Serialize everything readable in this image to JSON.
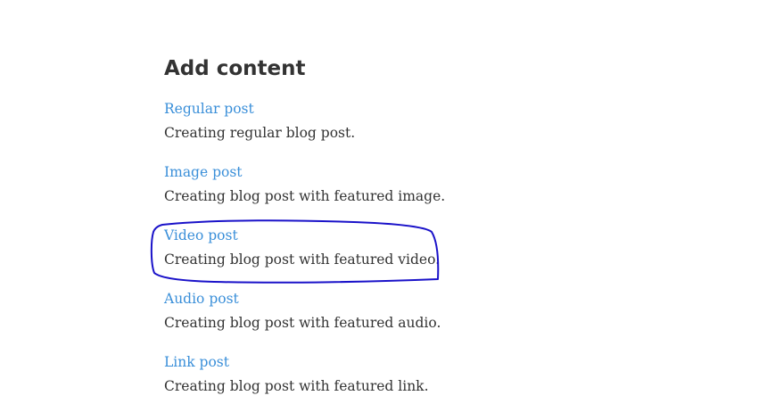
{
  "page_title": "Add content",
  "items": [
    {
      "label": "Regular post",
      "description": "Creating regular blog post."
    },
    {
      "label": "Image post",
      "description": "Creating blog post with featured image."
    },
    {
      "label": "Video post",
      "description": "Creating blog post with featured video."
    },
    {
      "label": "Audio post",
      "description": "Creating blog post with featured audio."
    },
    {
      "label": "Link post",
      "description": "Creating blog post with featured link."
    }
  ],
  "colors": {
    "link": "#3a8fd9",
    "text": "#333333",
    "heading": "#333333",
    "annotation_stroke": "#1a12c9"
  },
  "annotation": {
    "shape": "hand-drawn-ellipse",
    "highlighted_item": "Video post"
  }
}
